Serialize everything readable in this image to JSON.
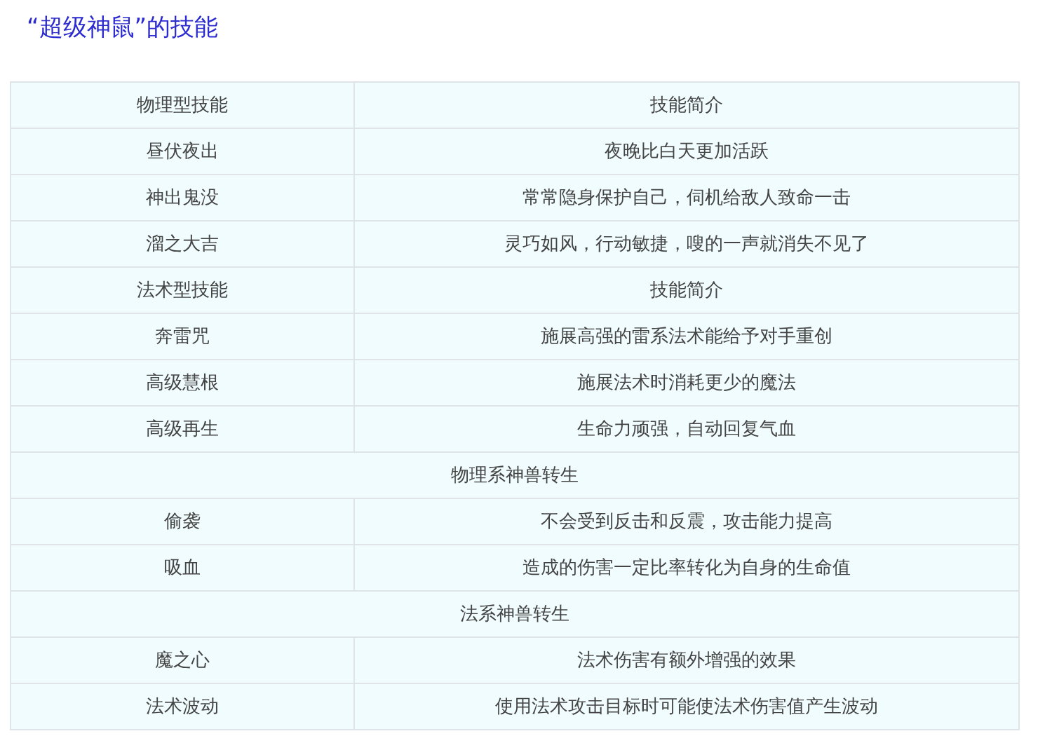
{
  "title": "“超级神鼠”的技能",
  "rows": [
    {
      "kind": "pair",
      "cells": [
        "物理型技能",
        "技能简介"
      ]
    },
    {
      "kind": "pair",
      "cells": [
        "昼伏夜出",
        "夜晚比白天更加活跃"
      ]
    },
    {
      "kind": "pair",
      "cells": [
        "神出鬼没",
        "常常隐身保护自己，伺机给敌人致命一击"
      ]
    },
    {
      "kind": "pair",
      "cells": [
        "溜之大吉",
        "灵巧如风，行动敏捷，嗖的一声就消失不见了"
      ]
    },
    {
      "kind": "pair",
      "cells": [
        "法术型技能",
        "技能简介"
      ]
    },
    {
      "kind": "pair",
      "cells": [
        "奔雷咒",
        "施展高强的雷系法术能给予对手重创"
      ]
    },
    {
      "kind": "pair",
      "cells": [
        "高级慧根",
        "施展法术时消耗更少的魔法"
      ]
    },
    {
      "kind": "pair",
      "cells": [
        "高级再生",
        "生命力顽强，自动回复气血"
      ]
    },
    {
      "kind": "section",
      "cells": [
        "物理系神兽转生"
      ]
    },
    {
      "kind": "pair",
      "cells": [
        "偷袭",
        "不会受到反击和反震，攻击能力提高"
      ]
    },
    {
      "kind": "pair",
      "cells": [
        "吸血",
        "造成的伤害一定比率转化为自身的生命值"
      ]
    },
    {
      "kind": "section",
      "cells": [
        "法系神兽转生"
      ]
    },
    {
      "kind": "pair",
      "cells": [
        "魔之心",
        "法术伤害有额外增强的效果"
      ]
    },
    {
      "kind": "pair",
      "cells": [
        "法术波动",
        "使用法术攻击目标时可能使法术伤害值产生波动"
      ]
    }
  ]
}
